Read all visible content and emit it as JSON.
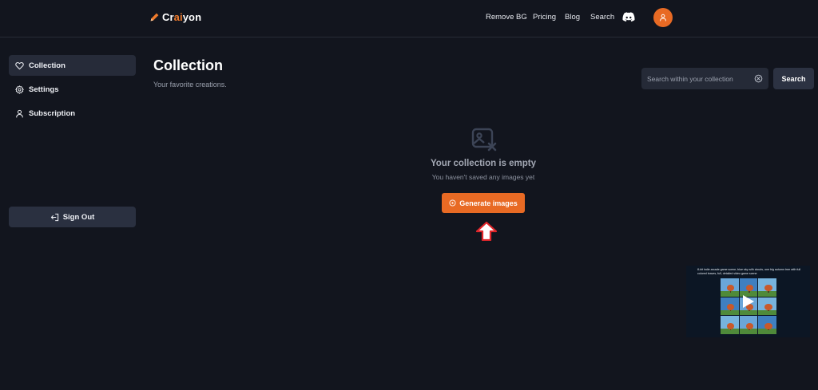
{
  "header": {
    "logo_prefix": "Cr",
    "logo_highlight": "ai",
    "logo_suffix": "yon",
    "nav": [
      {
        "label": "Remove BG"
      },
      {
        "label": "Pricing"
      },
      {
        "label": "Blog"
      },
      {
        "label": "Search"
      }
    ],
    "icons": {
      "discord": "discord-icon",
      "avatar": "user-icon",
      "logo": "pencil-icon"
    }
  },
  "sidebar": {
    "items": [
      {
        "label": "Collection",
        "icon": "heart-icon",
        "active": true
      },
      {
        "label": "Settings",
        "icon": "gear-icon",
        "active": false
      },
      {
        "label": "Subscription",
        "icon": "user-icon",
        "active": false
      }
    ],
    "signout_label": "Sign Out",
    "signout_icon": "sign-out-icon"
  },
  "main": {
    "title": "Collection",
    "subtitle": "Your favorite creations.",
    "search": {
      "placeholder": "Search within your collection",
      "value": "",
      "button_label": "Search"
    },
    "empty": {
      "title": "Your collection is empty",
      "subtitle": "You haven't saved any images yet",
      "button_label": "Generate images",
      "icon": "image-off-icon"
    }
  },
  "video_preview": {
    "caption": "8-bit indie arcade game scene, blue sky with clouds, one big autumn tree with full colored leaves, full, detailed video game scene"
  },
  "colors": {
    "background": "#12151e",
    "accent": "#e86a24",
    "sidebar_active": "#262b39",
    "arrow": "#e0262b"
  }
}
